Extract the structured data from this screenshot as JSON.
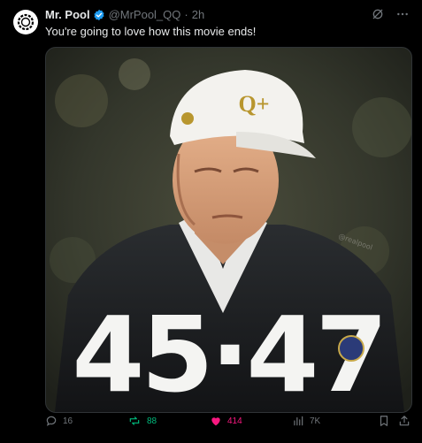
{
  "tweet": {
    "author_name": "Mr. Pool",
    "handle": "@MrPool_QQ",
    "separator": "·",
    "time": "2h",
    "text": "You're going to love how this movie ends!"
  },
  "image": {
    "hat_text": "Q+",
    "overlay_text": "45·47",
    "watermark": "@realpool"
  },
  "stats": {
    "replies": "16",
    "reposts": "88",
    "likes": "414",
    "views": "7K"
  },
  "colors": {
    "background": "#000000",
    "text": "#e7e9ea",
    "muted": "#71767b",
    "verified": "#1d9bf0",
    "repost_active": "#00ba7c",
    "like_active": "#f91880"
  },
  "icons": {
    "avatar": "grok-style-ring-icon",
    "verified": "verified-badge-icon",
    "grok": "grok-icon",
    "more": "more-icon",
    "reply": "reply-icon",
    "repost": "repost-icon",
    "like": "heart-icon",
    "views": "views-icon",
    "bookmark": "bookmark-icon",
    "share": "share-icon"
  }
}
